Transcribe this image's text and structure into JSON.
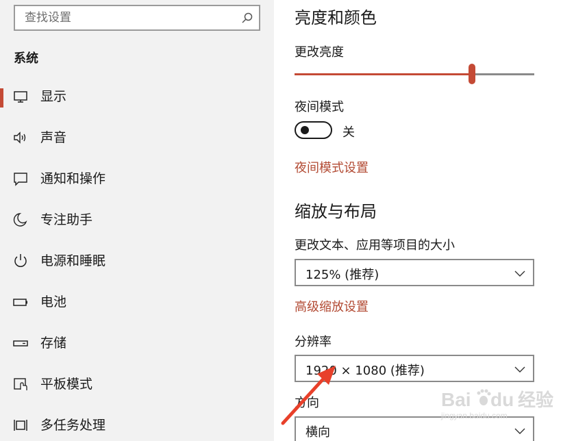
{
  "sidebar": {
    "search": {
      "placeholder": "查找设置"
    },
    "section_title": "系统",
    "items": [
      {
        "label": "显示",
        "icon": "monitor-icon",
        "active": true
      },
      {
        "label": "声音",
        "icon": "speaker-icon"
      },
      {
        "label": "通知和操作",
        "icon": "notification-icon"
      },
      {
        "label": "专注助手",
        "icon": "moon-icon"
      },
      {
        "label": "电源和睡眠",
        "icon": "power-icon"
      },
      {
        "label": "电池",
        "icon": "battery-icon"
      },
      {
        "label": "存储",
        "icon": "storage-icon"
      },
      {
        "label": "平板模式",
        "icon": "tablet-mode-icon"
      },
      {
        "label": "多任务处理",
        "icon": "multitasking-icon"
      }
    ]
  },
  "main": {
    "brightness": {
      "heading": "亮度和颜色",
      "label": "更改亮度",
      "value": 0.74
    },
    "night_light": {
      "label": "夜间模式",
      "state": "关",
      "settings_link": "夜间模式设置"
    },
    "scale_layout": {
      "heading": "缩放与布局",
      "scale_label": "更改文本、应用等项目的大小",
      "scale_value": "125% (推荐)",
      "advanced_link": "高级缩放设置",
      "resolution_label": "分辨率",
      "resolution_value": "1920 × 1080 (推荐)",
      "orientation_label": "方向",
      "orientation_value": "横向"
    }
  },
  "colors": {
    "accent": "#c44a35",
    "link": "#b24a33",
    "sidebar_bg": "#f2f2f2",
    "annotation_arrow": "#e8402a"
  },
  "watermark": {
    "brand": "Bai",
    "brand2": "du",
    "product": "经验",
    "domain": "jingyan.baidu.com"
  }
}
